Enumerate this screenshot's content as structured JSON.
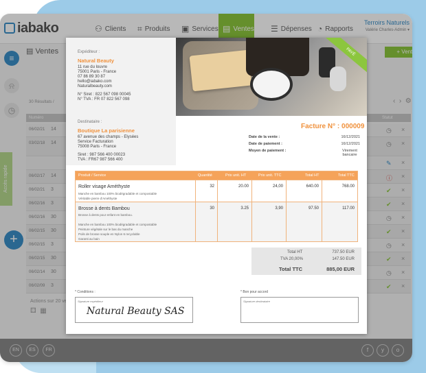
{
  "app": {
    "logo": "iabako",
    "user_name": "Terroirs Naturels",
    "user_sub": "Valérie Charles-Admin"
  },
  "nav": [
    {
      "label": "Clients",
      "icon": "person-icon"
    },
    {
      "label": "Produits",
      "icon": "tag-icon"
    },
    {
      "label": "Services",
      "icon": "briefcase-icon"
    },
    {
      "label": "Ventes",
      "icon": "cart-icon"
    },
    {
      "label": "Dépenses",
      "icon": "list-icon"
    },
    {
      "label": "Rapports",
      "icon": "chart-icon"
    }
  ],
  "page": {
    "title": "Ventes",
    "new_button": "Vente",
    "result_label": "Résultats /",
    "numero_header": "Numéro",
    "status_header": "Statut",
    "actions_label": "Actions sur 20 ventes"
  },
  "rows": [
    {
      "date": "06/02/21",
      "num": "14"
    },
    {
      "date": "03/02/18",
      "num": "14"
    },
    {
      "date": "",
      "num": ""
    },
    {
      "date": "06/02/17",
      "num": "14"
    },
    {
      "date": "06/02/21",
      "num": "3"
    },
    {
      "date": "06/02/16",
      "num": "3"
    },
    {
      "date": "06/02/16",
      "num": "30"
    },
    {
      "date": "06/02/15",
      "num": "30"
    },
    {
      "date": "06/02/15",
      "num": "3"
    },
    {
      "date": "06/02/15",
      "num": "30"
    },
    {
      "date": "06/02/14",
      "num": "30"
    },
    {
      "date": "06/02/09",
      "num": "3"
    }
  ],
  "footer": {
    "langs": [
      "EN",
      "ES",
      "FR"
    ],
    "social": [
      "f",
      "y",
      "o"
    ]
  },
  "invoice": {
    "expediteur_label": "Expéditeur :",
    "expediteur_name": "Natural Beauty",
    "expediteur_lines": [
      "11 rue du louvre",
      "75001 Paris - France",
      "07 86 89 30 87",
      "hello@iabako.com",
      "Naturalbeauty.com"
    ],
    "expediteur_ids": [
      "N° Siret : 822 567 098 00045",
      "N° TVA : FR 07 822 567 098"
    ],
    "destinataire_label": "Destinataire :",
    "destinataire_name": "Boutique La parisienne",
    "destinataire_lines": [
      "67 avenue des champs - Elysées",
      "Service Facturation",
      "75008 Paris - France"
    ],
    "destinataire_ids": [
      "Siret : 987 566 400 00023",
      "TVA : FR67 987 566 400"
    ],
    "ribbon": "PAYÉ",
    "title": "Facture N° : 000009",
    "date_vente_label": "Date de la vente :",
    "date_vente": "16/12/2021",
    "date_paiement_label": "Date de paiement :",
    "date_paiement": "16/12/2021",
    "moyen_label": "Moyen de paiement :",
    "moyen": "Virement bancaire",
    "headers": {
      "product": "Produit / Service",
      "qty": "Quantité",
      "ht": "Prix unit. HT",
      "ttc": "Prix unit. TTC",
      "total_ht": "Total HT",
      "total_ttc": "Total TTC"
    },
    "items": [
      {
        "name": "Roller visage Améthyste",
        "desc": [
          "Manche en bambou 100% biodégradable et compostable",
          "Véritable pierre d'Améthyste"
        ],
        "qty": "32",
        "ht": "20.00",
        "ttc": "24,00",
        "total_ht": "640.00",
        "total_ttc": "768.00"
      },
      {
        "name": "Brosse à dents Bambou",
        "desc": [
          "Brosse à dents pour enfant en bambou.",
          "",
          "Manche en bambou 100% biodégradable et compostable",
          "Peinture végétale sur le bas du manche",
          "Poils de brosse souple en Nylon 6 recyclable",
          "Garanti au bain"
        ],
        "qty": "30",
        "ht": "3.25",
        "ttc": "3,90",
        "total_ht": "97.50",
        "total_ttc": "117.00"
      }
    ],
    "total_ht_label": "Total HT",
    "total_ht": "737.50 EUR",
    "tva_label": "TVA 20,00%",
    "tva": "147.50 EUR",
    "total_ttc_label": "Total TTC",
    "total_ttc": "885,00 EUR",
    "conditions_label": "* Conditions :",
    "sig_expediteur_label": "Signature expéditeur",
    "sig_text": "Natural Beauty SAS",
    "bon_label": "* Bon pour accord",
    "sig_dest_label": "Signature destinataire"
  }
}
